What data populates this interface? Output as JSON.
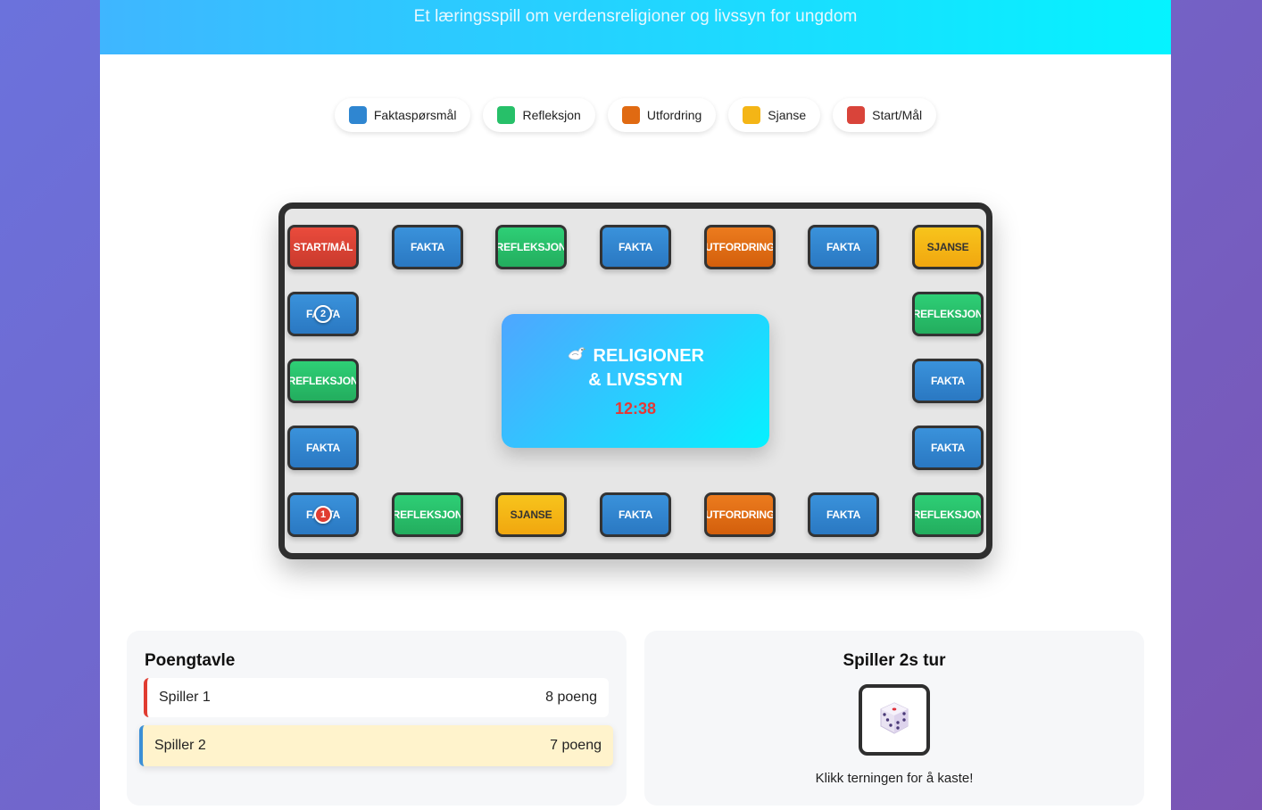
{
  "header": {
    "subtitle": "Et læringsspill om verdensreligioner og livssyn for ungdom"
  },
  "legend": [
    {
      "label": "Faktaspørsmål",
      "color": "#2f86d1"
    },
    {
      "label": "Refleksjon",
      "color": "#27c069"
    },
    {
      "label": "Utfordring",
      "color": "#e06a12"
    },
    {
      "label": "Sjanse",
      "color": "#f4b516"
    },
    {
      "label": "Start/Mål",
      "color": "#d9443a"
    }
  ],
  "board": {
    "top_row": [
      "START/MÅL",
      "FAKTA",
      "REFLEKSJON",
      "FAKTA",
      "UTFORDRING",
      "FAKTA",
      "SJANSE"
    ],
    "right_col": [
      "REFLEKSJON",
      "FAKTA",
      "FAKTA"
    ],
    "bottom_row": [
      "FAKTA",
      "REFLEKSJON",
      "SJANSE",
      "FAKTA",
      "UTFORDRING",
      "FAKTA",
      "REFLEKSJON"
    ],
    "left_col": [
      "FAKTA",
      "REFLEKSJON",
      "FAKTA"
    ],
    "tokens": {
      "player1": "1",
      "player2": "2"
    },
    "center": {
      "title": "RELIGIONER & LIVSSYN",
      "icon": "dove-icon",
      "timer": "12:38"
    }
  },
  "scoreboard": {
    "title": "Poengtavle",
    "players": [
      {
        "name": "Spiller 1",
        "score": "8 poeng",
        "color": "#e03c31"
      },
      {
        "name": "Spiller 2",
        "score": "7 poeng",
        "color": "#3b8fd6"
      }
    ]
  },
  "turn": {
    "title": "Spiller 2s tur",
    "dice_icon": "dice-icon",
    "hint": "Klikk terningen for å kaste!"
  }
}
